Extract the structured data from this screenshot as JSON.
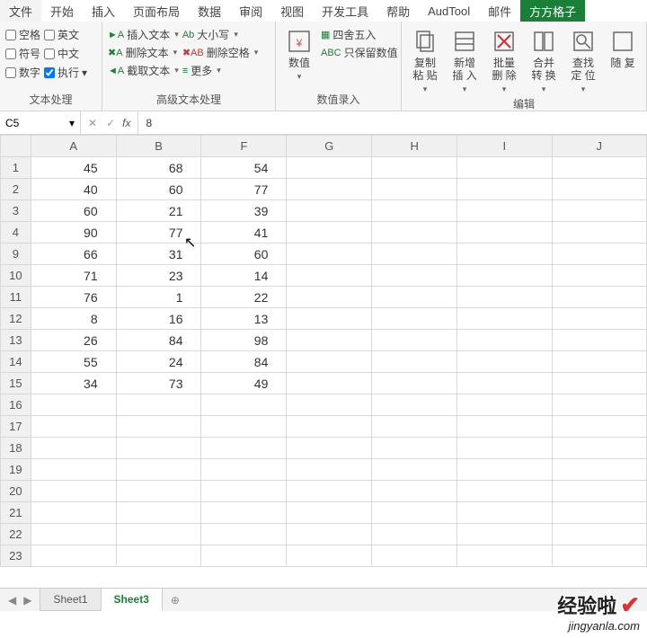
{
  "tabs": {
    "file": "文件",
    "home": "开始",
    "insert": "插入",
    "page_layout": "页面布局",
    "data": "数据",
    "review": "审阅",
    "view": "视图",
    "dev": "开发工具",
    "help": "帮助",
    "audtool": "AudTool",
    "mail": "邮件",
    "fangfang": "方方格子"
  },
  "ribbon": {
    "group1": {
      "chk_space": "空格",
      "chk_en": "英文",
      "chk_symbol": "符号",
      "chk_cn": "中文",
      "chk_number": "数字",
      "chk_exec": "执行",
      "label": "文本处理"
    },
    "group2": {
      "insert_text": "插入文本",
      "delete_text": "删除文本",
      "cut_text": "截取文本",
      "case": "大小写",
      "del_space": "删除空格",
      "more": "更多",
      "label": "高级文本处理"
    },
    "group3": {
      "numvalue": "数值",
      "round": "四舍五入",
      "keep_only": "只保留数值",
      "label": "数值录入"
    },
    "group4": {
      "copy_paste": "复制粘\n贴",
      "new_insert": "新增插\n入",
      "bulk_delete": "批量删\n除",
      "merge_convert": "合并转\n换",
      "find_locate": "查找定\n位",
      "random": "随\n复",
      "label": "编辑"
    }
  },
  "formula": {
    "cell_ref": "C5",
    "content": "8"
  },
  "columns": [
    "A",
    "B",
    "F",
    "G",
    "H",
    "I",
    "J"
  ],
  "rows": [
    "1",
    "2",
    "3",
    "4",
    "9",
    "10",
    "11",
    "12",
    "13",
    "14",
    "15",
    "16",
    "17",
    "18",
    "19",
    "20",
    "21",
    "22",
    "23"
  ],
  "cells": {
    "1": {
      "A": "45",
      "B": "68",
      "F": "54"
    },
    "2": {
      "A": "40",
      "B": "60",
      "F": "77"
    },
    "3": {
      "A": "60",
      "B": "21",
      "F": "39"
    },
    "4": {
      "A": "90",
      "B": "77",
      "F": "41"
    },
    "9": {
      "A": "66",
      "B": "31",
      "F": "60"
    },
    "10": {
      "A": "71",
      "B": "23",
      "F": "14"
    },
    "11": {
      "A": "76",
      "B": "1",
      "F": "22"
    },
    "12": {
      "A": "8",
      "B": "16",
      "F": "13"
    },
    "13": {
      "A": "26",
      "B": "84",
      "F": "98"
    },
    "14": {
      "A": "55",
      "B": "24",
      "F": "84"
    },
    "15": {
      "A": "34",
      "B": "73",
      "F": "49"
    }
  },
  "sheets": {
    "sheet1": "Sheet1",
    "sheet3": "Sheet3"
  },
  "watermark": {
    "big": "经验啦",
    "small": "jingyanla.com"
  }
}
